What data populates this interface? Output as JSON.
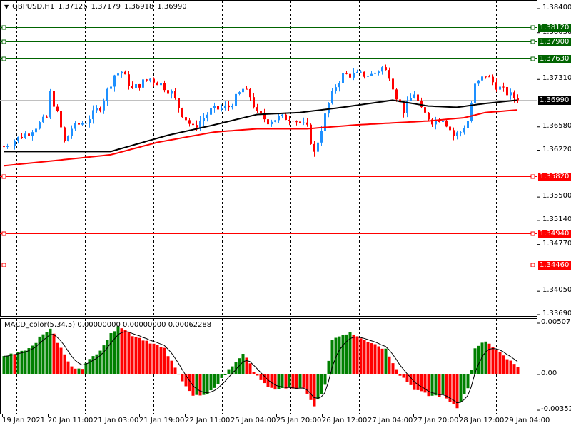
{
  "header": {
    "symbol": "GBPUSD,H1",
    "open": "1.37126",
    "high": "1.37179",
    "low": "1.36918",
    "close": "1.36990"
  },
  "macd_header": {
    "name": "MACD_color(5,34,5)",
    "v1": "0.00000000",
    "v2": "0.00000000",
    "v3": "0.00062288"
  },
  "price_axis": [
    "1.38400",
    "1.38030",
    "1.37310",
    "1.36580",
    "1.36220",
    "1.35500",
    "1.35140",
    "1.34770",
    "1.34050",
    "1.33690"
  ],
  "macd_axis": {
    "top": "0.0050758",
    "zero": "0.00",
    "bottom": "-0.003529"
  },
  "levels": [
    {
      "price": "1.38120",
      "color": "#006400"
    },
    {
      "price": "1.37900",
      "color": "#006400"
    },
    {
      "price": "1.37630",
      "color": "#006400"
    },
    {
      "price": "1.35820",
      "color": "#ff0000"
    },
    {
      "price": "1.34940",
      "color": "#ff0000"
    },
    {
      "price": "1.34460",
      "color": "#ff0000"
    }
  ],
  "current_price": "1.36990",
  "time_labels": [
    "19 Jan 2021",
    "20 Jan 11:00",
    "21 Jan 03:00",
    "21 Jan 19:00",
    "22 Jan 11:00",
    "25 Jan 04:00",
    "25 Jan 20:00",
    "26 Jan 12:00",
    "27 Jan 04:00",
    "27 Jan 20:00",
    "28 Jan 12:00",
    "29 Jan 04:00"
  ],
  "colors": {
    "bull": "#1e90ff",
    "bear": "#ff0000",
    "ma_fast": "#000000",
    "ma_slow": "#ff0000",
    "macd_up": "#008000",
    "macd_down": "#ff0000"
  },
  "chart_data": {
    "type": "candlestick",
    "bars": 145,
    "price_range": [
      1.3369,
      1.384
    ],
    "macd_range": [
      -0.003529,
      0.0050758
    ],
    "close_path": [
      [
        0,
        1.3628
      ],
      [
        7,
        1.365
      ],
      [
        12,
        1.3672
      ],
      [
        13,
        1.371
      ],
      [
        15,
        1.3678
      ],
      [
        17,
        1.3634
      ],
      [
        19,
        1.3656
      ],
      [
        23,
        1.3667
      ],
      [
        27,
        1.3689
      ],
      [
        31,
        1.3738
      ],
      [
        33,
        1.3743
      ],
      [
        36,
        1.3716
      ],
      [
        39,
        1.3727
      ],
      [
        41,
        1.3732
      ],
      [
        44,
        1.3724
      ],
      [
        47,
        1.371
      ],
      [
        50,
        1.3678
      ],
      [
        53,
        1.3656
      ],
      [
        55,
        1.3667
      ],
      [
        58,
        1.3683
      ],
      [
        63,
        1.3689
      ],
      [
        67,
        1.3716
      ],
      [
        69,
        1.3705
      ],
      [
        71,
        1.3678
      ],
      [
        74,
        1.3667
      ],
      [
        77,
        1.3672
      ],
      [
        81,
        1.3672
      ],
      [
        85,
        1.3656
      ],
      [
        87,
        1.3617
      ],
      [
        89,
        1.3656
      ],
      [
        91,
        1.3694
      ],
      [
        93,
        1.3721
      ],
      [
        95,
        1.3738
      ],
      [
        99,
        1.3738
      ],
      [
        103,
        1.3738
      ],
      [
        106,
        1.3749
      ],
      [
        108,
        1.3738
      ],
      [
        110,
        1.3705
      ],
      [
        112,
        1.3683
      ],
      [
        115,
        1.371
      ],
      [
        117,
        1.3683
      ],
      [
        120,
        1.3667
      ],
      [
        123,
        1.3672
      ],
      [
        126,
        1.3645
      ],
      [
        128,
        1.365
      ],
      [
        130,
        1.3667
      ],
      [
        132,
        1.3721
      ],
      [
        135,
        1.3738
      ],
      [
        138,
        1.3721
      ],
      [
        141,
        1.371
      ],
      [
        144,
        1.3699
      ]
    ],
    "ma_fast": [
      [
        0,
        1.362
      ],
      [
        30,
        1.362
      ],
      [
        46,
        1.3645
      ],
      [
        59,
        1.3661
      ],
      [
        71,
        1.3677
      ],
      [
        83,
        1.368
      ],
      [
        95,
        1.3688
      ],
      [
        109,
        1.3699
      ],
      [
        119,
        1.369
      ],
      [
        127,
        1.3688
      ],
      [
        135,
        1.3694
      ],
      [
        144,
        1.3699
      ]
    ],
    "ma_slow": [
      [
        0,
        1.3598
      ],
      [
        30,
        1.3615
      ],
      [
        43,
        1.3634
      ],
      [
        59,
        1.365
      ],
      [
        71,
        1.3655
      ],
      [
        85,
        1.3655
      ],
      [
        99,
        1.3661
      ],
      [
        119,
        1.3667
      ],
      [
        129,
        1.3672
      ],
      [
        135,
        1.368
      ],
      [
        144,
        1.3684
      ]
    ],
    "macd_hist": [
      [
        0,
        0.0018
      ],
      [
        7,
        0.0026
      ],
      [
        13,
        0.0046
      ],
      [
        15,
        0.0032
      ],
      [
        19,
        0.0007
      ],
      [
        22,
        0.0007
      ],
      [
        27,
        0.0025
      ],
      [
        32,
        0.0049
      ],
      [
        36,
        0.0039
      ],
      [
        41,
        0.0032
      ],
      [
        45,
        0.0025
      ],
      [
        49,
        0.0
      ],
      [
        53,
        -0.0021
      ],
      [
        57,
        -0.0021
      ],
      [
        61,
        -0.0004
      ],
      [
        67,
        0.0021
      ],
      [
        70,
        0.0004
      ],
      [
        74,
        -0.0014
      ],
      [
        79,
        -0.0014
      ],
      [
        84,
        -0.0014
      ],
      [
        87,
        -0.0032
      ],
      [
        90,
        -0.0011
      ],
      [
        92,
        0.0035
      ],
      [
        97,
        0.0042
      ],
      [
        101,
        0.0035
      ],
      [
        107,
        0.0025
      ],
      [
        111,
        0.0
      ],
      [
        115,
        -0.0014
      ],
      [
        119,
        -0.0021
      ],
      [
        123,
        -0.0021
      ],
      [
        127,
        -0.0032
      ],
      [
        130,
        -0.0014
      ],
      [
        132,
        0.0025
      ],
      [
        135,
        0.0033
      ],
      [
        139,
        0.0021
      ],
      [
        144,
        0.0007
      ]
    ]
  }
}
